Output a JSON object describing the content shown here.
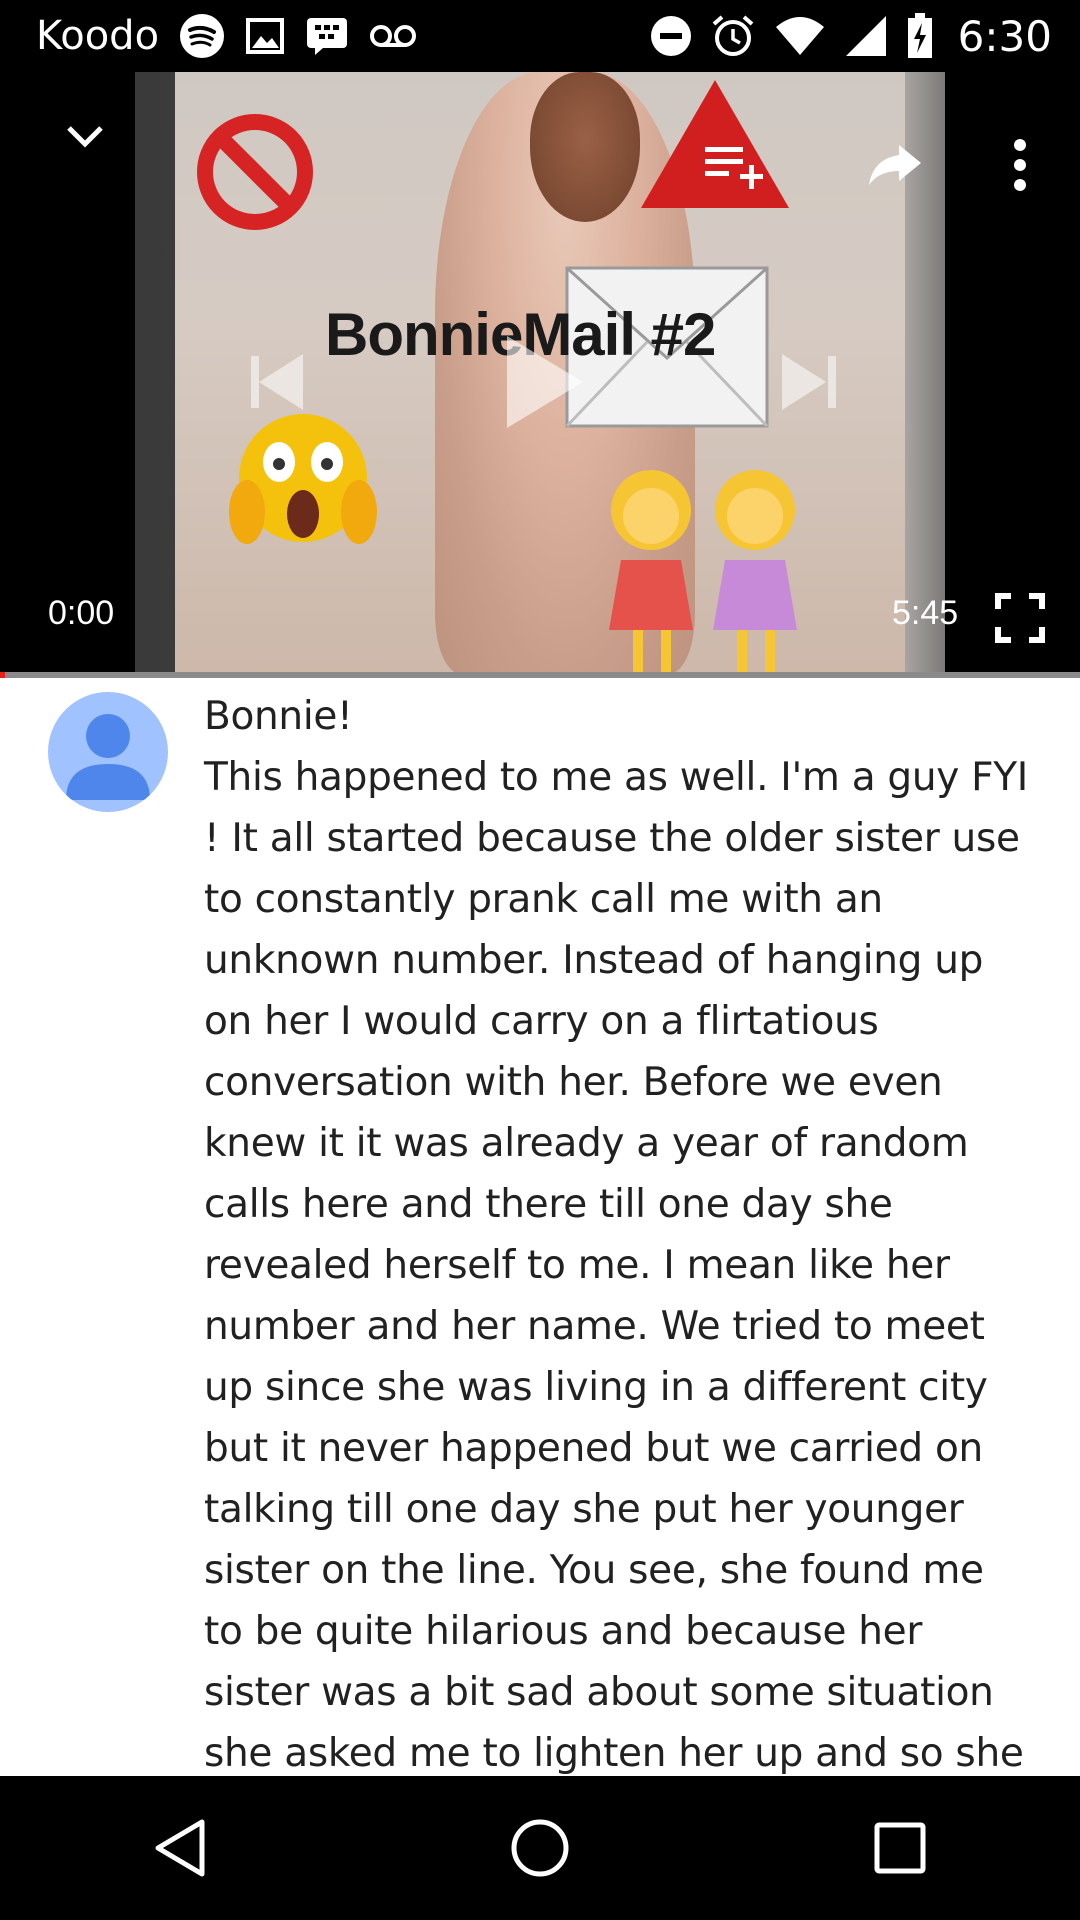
{
  "status_bar": {
    "carrier": "Koodo",
    "time": "6:30",
    "left_icons": [
      "spotify-icon",
      "image-icon",
      "bbm-icon",
      "voicemail-icon"
    ],
    "right_icons": [
      "do-not-disturb-icon",
      "alarm-icon",
      "wifi-icon",
      "signal-icon",
      "battery-charging-icon"
    ]
  },
  "player": {
    "thumbnail_caption": "BonnieMail #2",
    "current_time": "0:00",
    "duration": "5:45",
    "progress": 0.0,
    "accent_color": "#e62117"
  },
  "comment": {
    "author": "Bonnie!",
    "text": "This happened to me as well. I'm a guy FYI ! It all started because the older sister use to constantly prank call me with an unknown number. Instead of hanging up on her I would carry on a flirtatious conversation with her. Before we even knew it it was already a year of random calls here and there till one day she revealed herself to me. I mean like her number and her name. We tried to meet up since she was living in a different city but it never happened but we carried on talking till one day she put her younger sister on the line. You see, she found me to be quite hilarious and because her sister was a bit sad about some situation she asked me to lighten her up and so she put her in three-way call. I tried",
    "avatar_color": "#a0c3ff"
  },
  "nav_bar": {
    "icons": [
      "back-icon",
      "home-icon",
      "recents-icon"
    ]
  }
}
